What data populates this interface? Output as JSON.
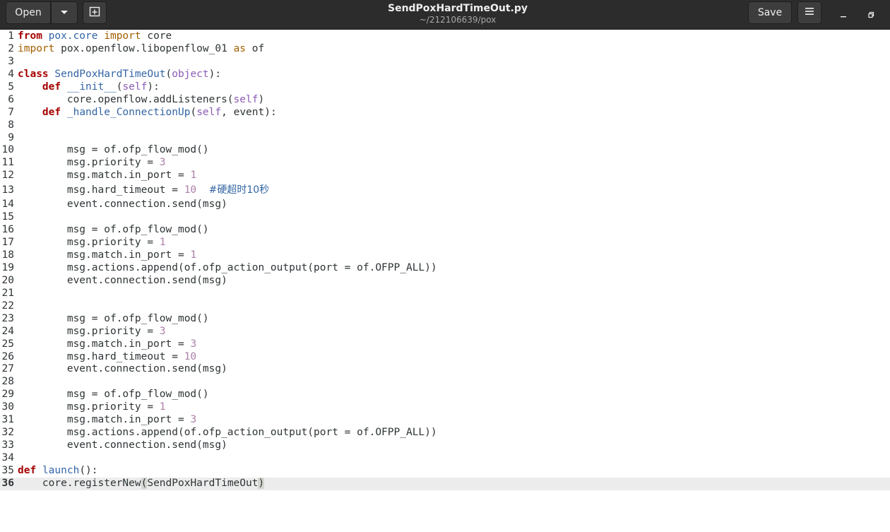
{
  "window": {
    "title": "SendPoxHardTimeOut.py",
    "subtitle": "~/212106639/pox"
  },
  "toolbar": {
    "open_label": "Open",
    "open_menu_icon": "chevron-down-icon",
    "new_tab_icon": "new-document-icon",
    "save_label": "Save",
    "menu_icon": "hamburger-menu-icon",
    "minimize_icon": "minimize-icon",
    "maximize_icon": "maximize-icon"
  },
  "editor": {
    "current_line": 36,
    "lines": [
      {
        "n": "1",
        "segs": [
          [
            "kw2",
            "from"
          ],
          [
            "txt",
            " "
          ],
          [
            "mod",
            "pox.core"
          ],
          [
            "txt",
            " "
          ],
          [
            "imp",
            "import"
          ],
          [
            "txt",
            " core"
          ]
        ]
      },
      {
        "n": "2",
        "segs": [
          [
            "imp",
            "import"
          ],
          [
            "txt",
            " pox.openflow.libopenflow_01 "
          ],
          [
            "imp",
            "as"
          ],
          [
            "txt",
            " of"
          ]
        ]
      },
      {
        "n": "3",
        "segs": []
      },
      {
        "n": "4",
        "segs": [
          [
            "kw",
            "class"
          ],
          [
            "txt",
            " "
          ],
          [
            "fn",
            "SendPoxHardTimeOut"
          ],
          [
            "txt",
            "("
          ],
          [
            "bi",
            "object"
          ],
          [
            "txt",
            "):"
          ]
        ]
      },
      {
        "n": "5",
        "segs": [
          [
            "txt",
            "    "
          ],
          [
            "kw",
            "def"
          ],
          [
            "txt",
            " "
          ],
          [
            "fn",
            "__init__"
          ],
          [
            "txt",
            "("
          ],
          [
            "bi",
            "self"
          ],
          [
            "txt",
            "):"
          ]
        ]
      },
      {
        "n": "6",
        "segs": [
          [
            "txt",
            "        core.openflow.addListeners("
          ],
          [
            "bi",
            "self"
          ],
          [
            "txt",
            ")"
          ]
        ]
      },
      {
        "n": "7",
        "segs": [
          [
            "txt",
            "    "
          ],
          [
            "kw",
            "def"
          ],
          [
            "txt",
            " "
          ],
          [
            "fn",
            "_handle_ConnectionUp"
          ],
          [
            "txt",
            "("
          ],
          [
            "bi",
            "self"
          ],
          [
            "txt",
            ", event):"
          ]
        ]
      },
      {
        "n": "8",
        "segs": []
      },
      {
        "n": "9",
        "segs": []
      },
      {
        "n": "10",
        "segs": [
          [
            "txt",
            "        msg = of.ofp_flow_mod()"
          ]
        ]
      },
      {
        "n": "11",
        "segs": [
          [
            "txt",
            "        msg.priority = "
          ],
          [
            "num",
            "3"
          ]
        ]
      },
      {
        "n": "12",
        "segs": [
          [
            "txt",
            "        msg.match.in_port = "
          ],
          [
            "num",
            "1"
          ]
        ]
      },
      {
        "n": "13",
        "tall": true,
        "segs": [
          [
            "txt",
            "        msg.hard_timeout = "
          ],
          [
            "num",
            "10"
          ],
          [
            "txt",
            "  "
          ],
          [
            "cm",
            "#硬超时10秒"
          ]
        ]
      },
      {
        "n": "14",
        "segs": [
          [
            "txt",
            "        event.connection.send(msg)"
          ]
        ]
      },
      {
        "n": "15",
        "segs": []
      },
      {
        "n": "16",
        "segs": [
          [
            "txt",
            "        msg = of.ofp_flow_mod()"
          ]
        ]
      },
      {
        "n": "17",
        "segs": [
          [
            "txt",
            "        msg.priority = "
          ],
          [
            "num",
            "1"
          ]
        ]
      },
      {
        "n": "18",
        "segs": [
          [
            "txt",
            "        msg.match.in_port = "
          ],
          [
            "num",
            "1"
          ]
        ]
      },
      {
        "n": "19",
        "segs": [
          [
            "txt",
            "        msg.actions.append(of.ofp_action_output(port = of.OFPP_ALL))"
          ]
        ]
      },
      {
        "n": "20",
        "segs": [
          [
            "txt",
            "        event.connection.send(msg)"
          ]
        ]
      },
      {
        "n": "21",
        "segs": []
      },
      {
        "n": "22",
        "segs": []
      },
      {
        "n": "23",
        "segs": [
          [
            "txt",
            "        msg = of.ofp_flow_mod()"
          ]
        ]
      },
      {
        "n": "24",
        "segs": [
          [
            "txt",
            "        msg.priority = "
          ],
          [
            "num",
            "3"
          ]
        ]
      },
      {
        "n": "25",
        "segs": [
          [
            "txt",
            "        msg.match.in_port = "
          ],
          [
            "num",
            "3"
          ]
        ]
      },
      {
        "n": "26",
        "segs": [
          [
            "txt",
            "        msg.hard_timeout = "
          ],
          [
            "num",
            "10"
          ]
        ]
      },
      {
        "n": "27",
        "segs": [
          [
            "txt",
            "        event.connection.send(msg)"
          ]
        ]
      },
      {
        "n": "28",
        "segs": []
      },
      {
        "n": "29",
        "segs": [
          [
            "txt",
            "        msg = of.ofp_flow_mod()"
          ]
        ]
      },
      {
        "n": "30",
        "segs": [
          [
            "txt",
            "        msg.priority = "
          ],
          [
            "num",
            "1"
          ]
        ]
      },
      {
        "n": "31",
        "segs": [
          [
            "txt",
            "        msg.match.in_port = "
          ],
          [
            "num",
            "3"
          ]
        ]
      },
      {
        "n": "32",
        "segs": [
          [
            "txt",
            "        msg.actions.append(of.ofp_action_output(port = of.OFPP_ALL))"
          ]
        ]
      },
      {
        "n": "33",
        "segs": [
          [
            "txt",
            "        event.connection.send(msg)"
          ]
        ]
      },
      {
        "n": "34",
        "segs": []
      },
      {
        "n": "35",
        "segs": [
          [
            "kw",
            "def"
          ],
          [
            "txt",
            " "
          ],
          [
            "fn",
            "launch"
          ],
          [
            "txt",
            "():"
          ]
        ]
      },
      {
        "n": "36",
        "current": true,
        "segs": [
          [
            "txt",
            "    core.registerNew"
          ],
          [
            "paren",
            "("
          ],
          [
            "txt",
            "SendPoxHardTimeOut"
          ],
          [
            "paren",
            ")"
          ]
        ]
      }
    ]
  }
}
